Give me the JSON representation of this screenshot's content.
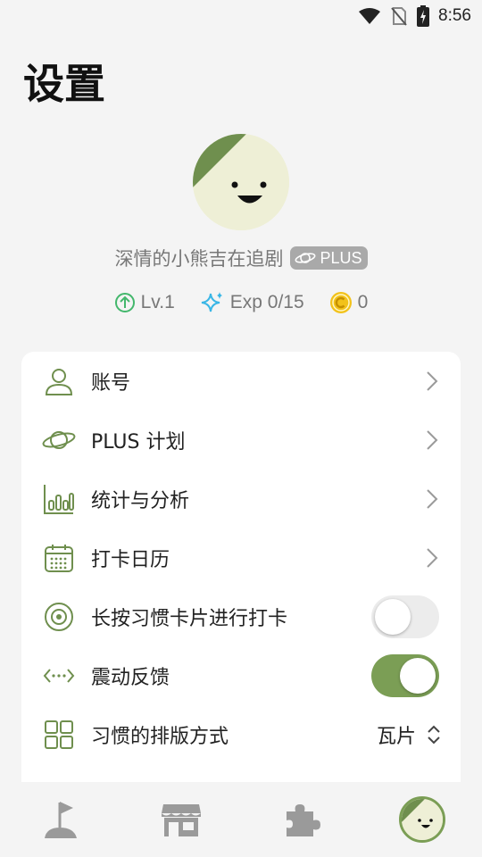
{
  "status_bar": {
    "time": "8:56"
  },
  "page": {
    "title": "设置"
  },
  "profile": {
    "nickname": "深情的小熊吉在追剧",
    "badge": "PLUS",
    "level": "Lv.1",
    "exp": "Exp 0/15",
    "coins": "0"
  },
  "settings": {
    "items": [
      {
        "label": "账号",
        "icon": "user-icon",
        "type": "link"
      },
      {
        "label": "PLUS 计划",
        "icon": "planet-icon",
        "type": "link"
      },
      {
        "label": "统计与分析",
        "icon": "bar-chart-icon",
        "type": "link"
      },
      {
        "label": "打卡日历",
        "icon": "calendar-icon",
        "type": "link"
      },
      {
        "label": "长按习惯卡片进行打卡",
        "icon": "target-icon",
        "type": "toggle",
        "on": false
      },
      {
        "label": "震动反馈",
        "icon": "vibration-icon",
        "type": "toggle",
        "on": true
      },
      {
        "label": "习惯的排版方式",
        "icon": "grid-icon",
        "type": "select",
        "value": "瓦片"
      }
    ]
  },
  "bottom_nav": {
    "items": [
      {
        "icon": "flag-icon"
      },
      {
        "icon": "store-icon"
      },
      {
        "icon": "puzzle-icon"
      },
      {
        "icon": "avatar-icon",
        "active": true
      }
    ]
  },
  "colors": {
    "accent": "#7b9e55",
    "icon_green": "#6f8f4e",
    "background": "#f4f4f4",
    "card": "#ffffff",
    "coin": "#f2c21a",
    "exp_star": "#39b6e6",
    "level_green": "#43b76c"
  }
}
